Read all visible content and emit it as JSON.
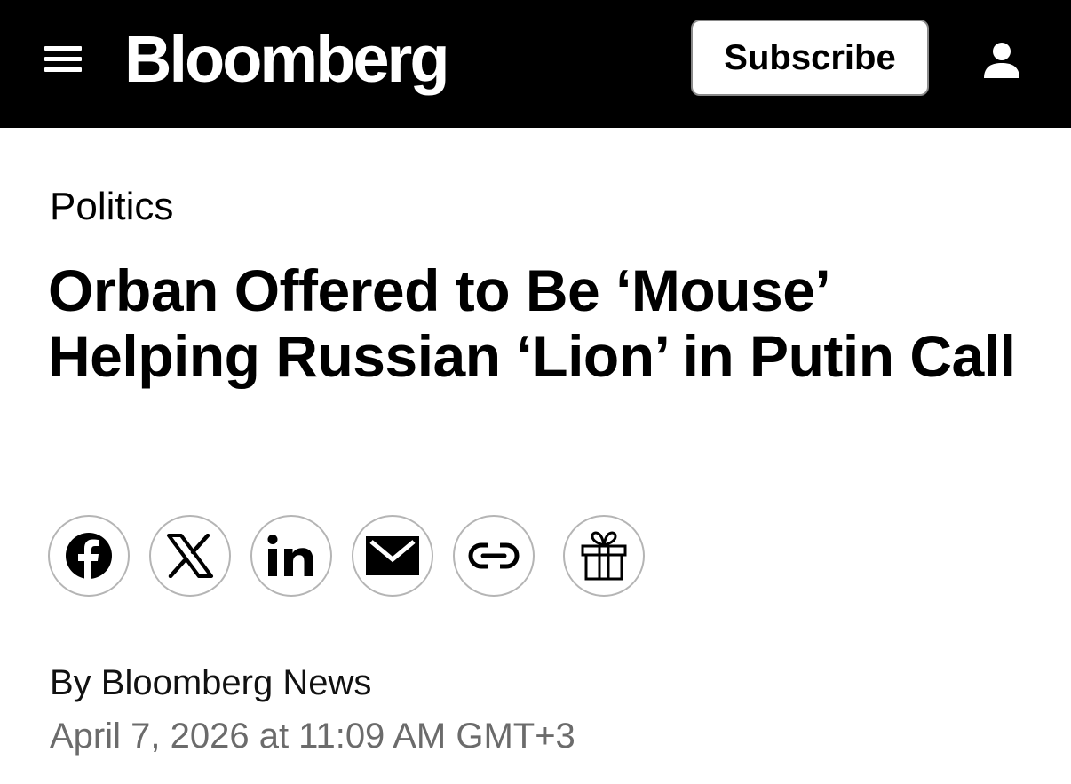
{
  "header": {
    "logo_text": "Bloomberg",
    "subscribe_label": "Subscribe",
    "background_color": "#000000",
    "menu_icon": "hamburger-menu-icon",
    "account_icon": "user-account-icon"
  },
  "article": {
    "category": "Politics",
    "headline": "Orban Offered to Be ‘Mouse’ Helping Russian ‘Lion’ in Putin Call",
    "byline": "By Bloomberg News",
    "timestamp": "April 7, 2026 at 11:09 AM GMT+3"
  },
  "share_buttons": [
    {
      "icon": "facebook-icon"
    },
    {
      "icon": "x-twitter-icon"
    },
    {
      "icon": "linkedin-icon"
    },
    {
      "icon": "email-icon"
    },
    {
      "icon": "copy-link-icon"
    },
    {
      "icon": "gift-icon"
    }
  ]
}
